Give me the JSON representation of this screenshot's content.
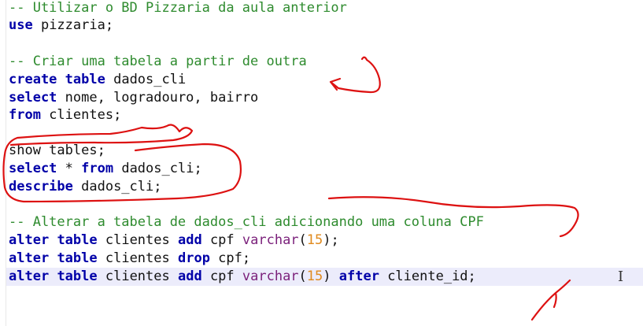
{
  "lines": [
    {
      "c1": "-- Utilizar o BD Pizzaria da aula anterior"
    },
    {
      "k1": "use",
      "t1": " pizzaria;"
    },
    {},
    {
      "c1": "-- Criar uma tabela a partir de outra"
    },
    {
      "k1": "create",
      "k2": "table",
      "t1": " dados_cli"
    },
    {
      "k1": "select",
      "t1": " nome, logradouro, bairro"
    },
    {
      "k1": "from",
      "t1": " clientes;"
    },
    {},
    {
      "t1": "show tables;"
    },
    {
      "k1": "select",
      "t1": " * ",
      "k2": "from",
      "t2": " dados_cli;"
    },
    {
      "k1": "describe",
      "t1": " dados_cli;"
    },
    {},
    {
      "c1": "-- Alterar a tabela de dados_cli adicionando uma coluna CPF"
    },
    {
      "k1": "alter",
      "k2": "table",
      "t1": " clientes ",
      "k3": "add",
      "t2": " cpf ",
      "f1": "varchar",
      "p1": "(",
      "n1": "15",
      "p2": ");"
    },
    {
      "k1": "alter",
      "k2": "table",
      "t1": " clientes ",
      "k3": "drop",
      "t2": " cpf;"
    },
    {
      "k1": "alter",
      "k2": "table",
      "t1": " clientes ",
      "k3": "add",
      "t2": " cpf ",
      "f1": "varchar",
      "p1": "(",
      "n1": "15",
      "p2": ") ",
      "k4": "after",
      "t3": " cliente_id;"
    }
  ],
  "cursor_glyph": "I",
  "colors": {
    "comment": "#2e8b2e",
    "keyword": "#0000a8",
    "function": "#7a1f7a",
    "number": "#e08a1e",
    "annotation": "#dd1111",
    "current_line": "#ececfb"
  }
}
